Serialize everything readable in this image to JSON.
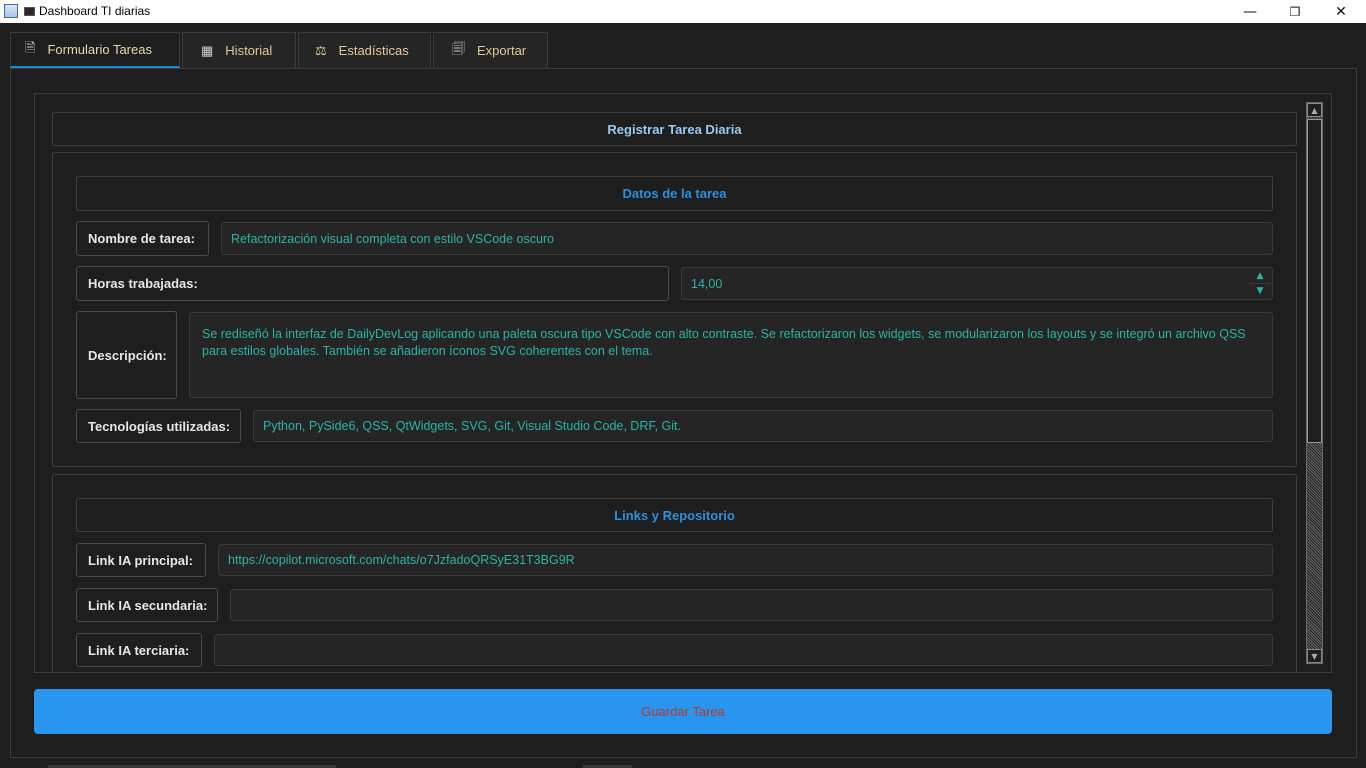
{
  "window": {
    "title": "Dashboard TI diarias",
    "minimize": "—",
    "restore": "❐",
    "close": "✕"
  },
  "tabs": [
    {
      "label": "Formulario Tareas",
      "icon": "document-icon",
      "glyph": "🗎"
    },
    {
      "label": "Historial",
      "icon": "history-icon",
      "glyph": "▦"
    },
    {
      "label": "Estadísticas",
      "icon": "scale-icon",
      "glyph": "⚖"
    },
    {
      "label": "Exportar",
      "icon": "export-icon",
      "glyph": "🗐"
    }
  ],
  "form": {
    "header": "Registrar Tarea Diaria",
    "task_section": {
      "title": "Datos de la tarea",
      "name_label": "Nombre de tarea:",
      "name_value": "Refactorización visual completa con estilo VSCode oscuro",
      "hours_label": "Horas trabajadas:",
      "hours_value": "14,00",
      "description_label": "Descripción:",
      "description_value": "Se rediseñó la interfaz de DailyDevLog aplicando una paleta oscura tipo VSCode con alto contraste. Se refactorizaron los widgets, se modularizaron los layouts y se integró un archivo QSS para estilos globales. También se añadieron íconos SVG coherentes con el tema.",
      "tech_label": "Tecnologías utilizadas:",
      "tech_value": "Python, PySide6, QSS, QtWidgets, SVG, Git, Visual Studio Code, DRF, Git."
    },
    "links_section": {
      "title": "Links y Repositorio",
      "ia_main_label": "Link IA principal:",
      "ia_main_value": "https://copilot.microsoft.com/chats/o7JzfadoQRSyE31T3BG9R",
      "ia_secondary_label": "Link IA secundaria:",
      "ia_secondary_value": "",
      "ia_tertiary_label": "Link IA terciaria:",
      "ia_tertiary_value": ""
    },
    "save_button": "Guardar Tarea"
  },
  "colors": {
    "background": "#1e1e1e",
    "accent": "#2a95ee",
    "section_title": "#2c8fe0",
    "field_text": "#2bb3a6",
    "tab_text": "#e2c896"
  }
}
